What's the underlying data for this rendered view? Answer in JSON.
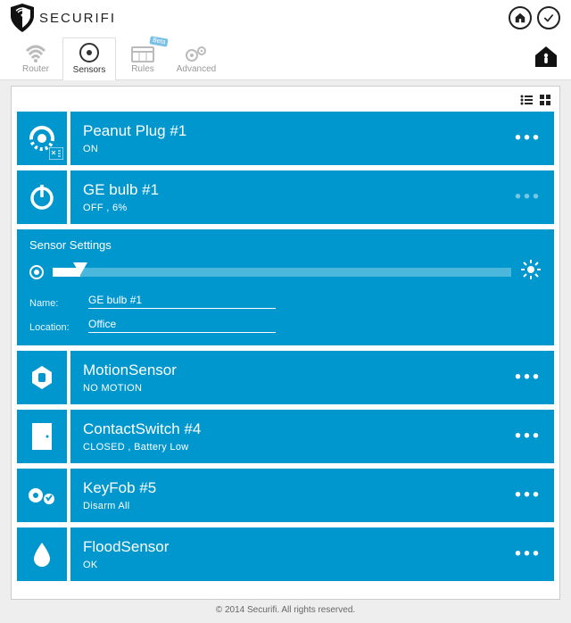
{
  "brand": "SECURIFI",
  "nav": {
    "router": "Router",
    "sensors": "Sensors",
    "rules": "Rules",
    "advanced": "Advanced",
    "beta_badge": "Beta"
  },
  "settings": {
    "heading": "Sensor Settings",
    "name_label": "Name:",
    "name_value": "GE bulb #1",
    "location_label": "Location:",
    "location_value": "Office",
    "slider_percent": 6
  },
  "sensors": [
    {
      "title": "Peanut Plug #1",
      "status": "ON"
    },
    {
      "title": "GE bulb #1",
      "status": "OFF  , 6%"
    },
    {
      "title": "MotionSensor",
      "status": "NO MOTION"
    },
    {
      "title": "ContactSwitch #4",
      "status": "CLOSED  , Battery Low"
    },
    {
      "title": "KeyFob #5",
      "status": "Disarm All"
    },
    {
      "title": "FloodSensor",
      "status": "OK"
    }
  ],
  "footer": "© 2014 Securifi. All rights reserved."
}
